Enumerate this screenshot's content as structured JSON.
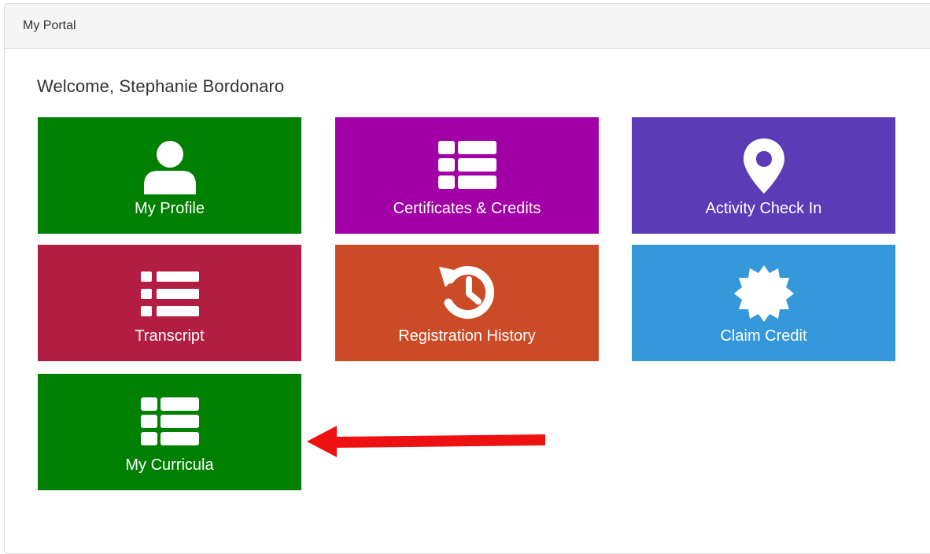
{
  "panel": {
    "title": "My Portal"
  },
  "welcome": {
    "text": "Welcome, Stephanie Bordonaro"
  },
  "tiles": [
    {
      "label": "My Profile",
      "icon": "user-icon",
      "color": "#008000"
    },
    {
      "label": "Certificates & Credits",
      "icon": "th-list-icon",
      "color": "#a100a6"
    },
    {
      "label": "Activity Check In",
      "icon": "map-marker-icon",
      "color": "#5c3bb7"
    },
    {
      "label": "Transcript",
      "icon": "list-icon",
      "color": "#b21d41"
    },
    {
      "label": "Registration History",
      "icon": "history-icon",
      "color": "#cc4b27"
    },
    {
      "label": "Claim Credit",
      "icon": "certificate-icon",
      "color": "#3498db"
    },
    {
      "label": "My Curricula",
      "icon": "th-list-icon",
      "color": "#008000"
    }
  ],
  "annotation": {
    "arrow_color": "#ee1111",
    "icon": "left-arrow-annotation"
  }
}
